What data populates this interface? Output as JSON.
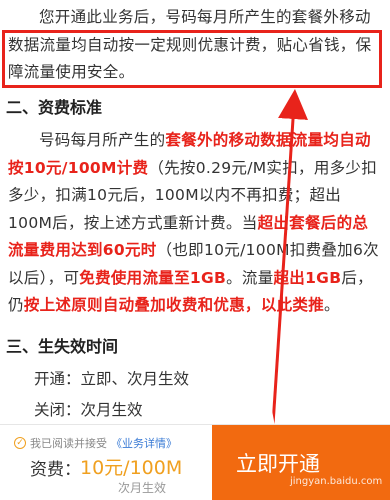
{
  "intro": {
    "text": "您开通此业务后，号码每月所产生的套餐外移动数据流量均自动按一定规则优惠计费，贴心省钱，保障流量使用安全。"
  },
  "section2": {
    "title": "二、资费标准",
    "p1": "号码每月所产生的",
    "r1": "套餐外的移动数据流量均自动按10元/100M计费",
    "p2": "（先按0.29元/M实扣，用多少扣多少，扣满10元后，100M以内不再扣费；超出100M后，按上述方式重新计费。当",
    "r2": "超出套餐后的总流量费用达到60元时",
    "p3": "（也即10元/100M扣费叠加6次以后），可",
    "r3": "免费使用流量至1GB",
    "p4": "。流量",
    "r4": "超出1GB",
    "p5": "后，仍",
    "r5": "按上述原则自动叠加收费和优惠，以此类推",
    "p6": "。"
  },
  "section3": {
    "title": "三、生失效时间",
    "open_label": "开通：",
    "open_value": "立即、次月生效",
    "close_label": "关闭：",
    "close_value": "次月生效"
  },
  "bottom": {
    "agree_text": "我已阅读并接受",
    "agree_link": "《业务详情》",
    "fee_label": "资费：",
    "fee_value": "10元/100M",
    "effect": "次月生效",
    "open_button": "立即开通",
    "watermark": "jingyan.baidu.com"
  },
  "colors": {
    "accent_red": "#e8231b",
    "button_orange": "#f26a10",
    "fee_orange": "#f0a020"
  },
  "icons": [
    "check-circle-icon",
    "annotation-arrow-icon"
  ]
}
